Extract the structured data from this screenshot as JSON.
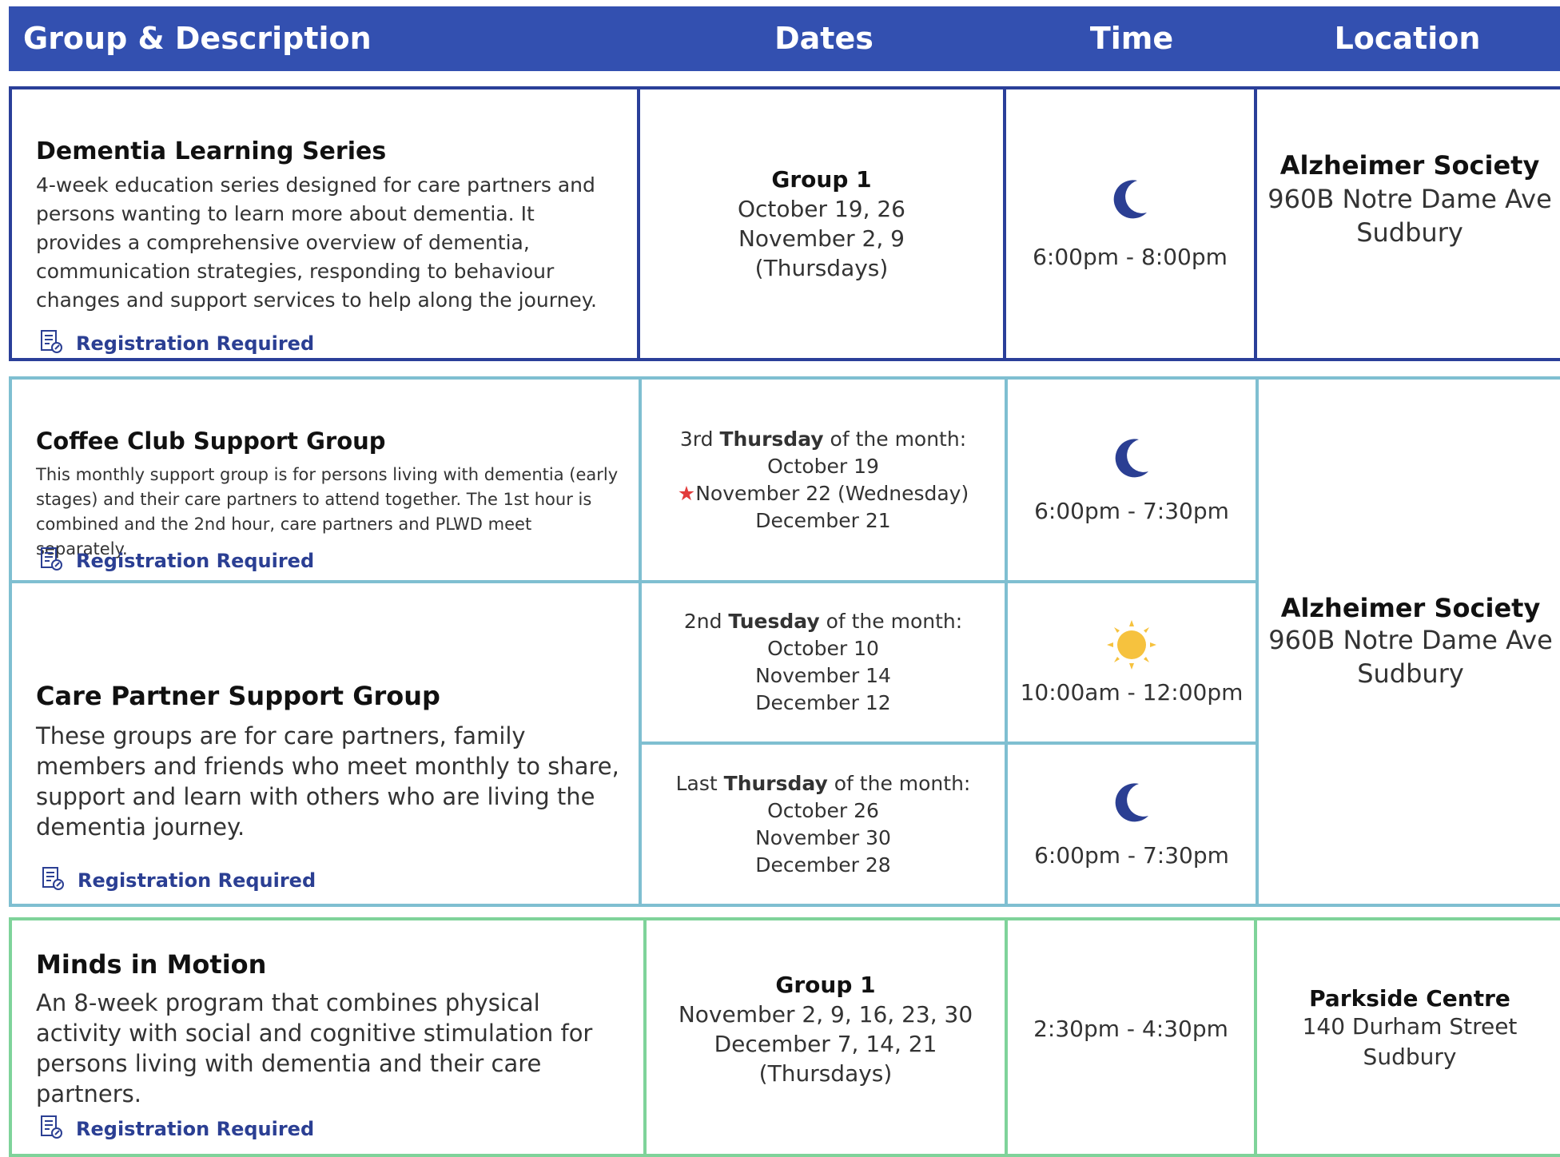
{
  "header": {
    "group": "Group & Description",
    "dates": "Dates",
    "time": "Time",
    "location": "Location",
    "bg_color": "#3350b0"
  },
  "registration_label": "Registration Required",
  "rows": [
    {
      "title": "Dementia Learning Series",
      "description": "4-week education series designed for care partners and persons wanting to learn more about dementia. It provides a comprehensive overview of dementia, communication strategies, responding to behaviour changes and support services to help along the journey.",
      "dates_group": "Group 1",
      "dates_lines": [
        "October 19, 26",
        "November 2, 9",
        "(Thursdays)"
      ],
      "time_icon": "moon-icon",
      "time": "6:00pm - 8:00pm",
      "location_name": "Alzheimer Society",
      "location_lines": [
        "960B Notre Dame Ave",
        "Sudbury"
      ],
      "border_color": "#2a3f99"
    },
    {
      "title": "Coffee Club Support Group",
      "description": "This monthly support group is for persons living with dementia (early stages) and their care partners to attend together. The 1st hour is combined and the 2nd hour, care partners and PLWD meet separately.",
      "dates_prefix": "3rd",
      "dates_day": "Thursday",
      "dates_suffix": "of the month:",
      "dates_lines": [
        "October 19",
        "November 22 (Wednesday)",
        "December 21"
      ],
      "star_symbol": "★",
      "time_icon": "moon-icon",
      "time": "6:00pm - 7:30pm",
      "border_color": "#7fbfd1"
    },
    {
      "title": "Care Partner Support Group",
      "description": "These groups are for care partners, family members and friends who meet monthly to share, support and learn with others who are living the dementia journey.",
      "sessions": [
        {
          "dates_prefix": "2nd",
          "dates_day": "Tuesday",
          "dates_suffix": "of the month:",
          "dates_lines": [
            "October 10",
            "November 14",
            "December 12"
          ],
          "time_icon": "sun-icon",
          "time": "10:00am - 12:00pm"
        },
        {
          "dates_prefix": "Last",
          "dates_day": "Thursday",
          "dates_suffix": "of the month:",
          "dates_lines": [
            "October 26",
            "November 30",
            "December 28"
          ],
          "time_icon": "moon-icon",
          "time": "6:00pm - 7:30pm"
        }
      ],
      "location_name": "Alzheimer Society",
      "location_lines": [
        "960B Notre Dame Ave",
        "Sudbury"
      ],
      "border_color": "#7fbfd1"
    },
    {
      "title": "Minds in Motion",
      "description": "An 8-week program that combines physical activity with social and cognitive stimulation for persons living with dementia and their care partners.",
      "dates_group": "Group 1",
      "dates_lines": [
        "November 2, 9, 16, 23, 30",
        "December 7, 14, 21",
        "(Thursdays)"
      ],
      "time": "2:30pm - 4:30pm",
      "location_name": "Parkside Centre",
      "location_lines": [
        "140 Durham Street",
        "Sudbury"
      ],
      "border_color": "#7fd39a"
    }
  ]
}
